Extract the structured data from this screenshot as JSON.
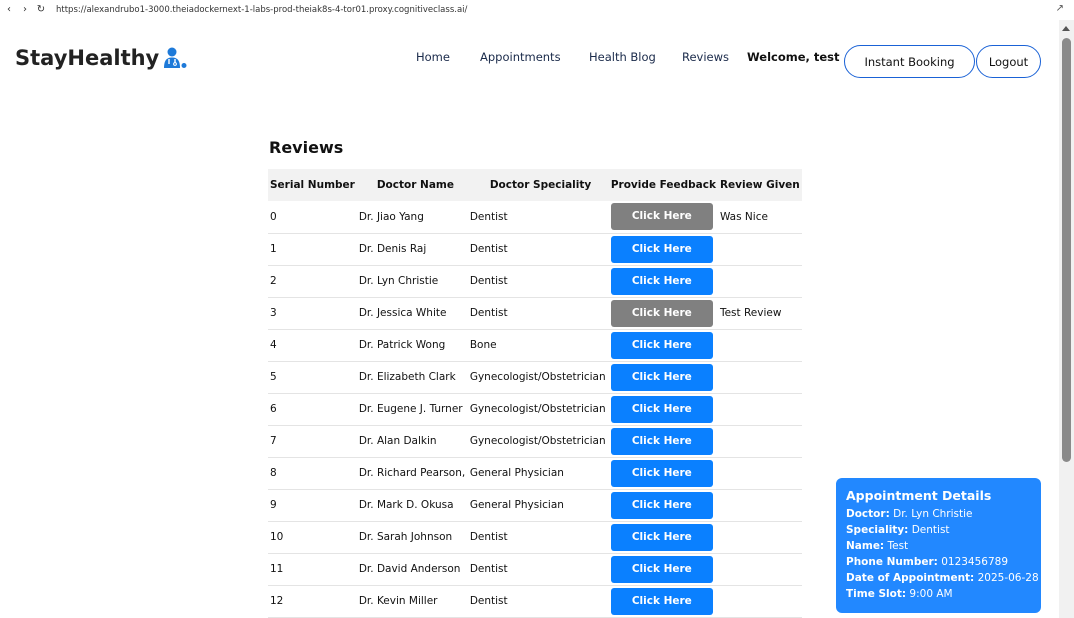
{
  "browser": {
    "url": "https://alexandrubo1-3000.theiadockernext-1-labs-prod-theiak8s-4-tor01.proxy.cognitiveclass.ai/"
  },
  "header": {
    "logo_text": "StayHealthy",
    "nav": {
      "home": "Home",
      "appointments": "Appointments",
      "blog": "Health Blog",
      "reviews": "Reviews"
    },
    "welcome": "Welcome, test",
    "instant_booking": "Instant Booking",
    "logout": "Logout"
  },
  "reviews": {
    "title": "Reviews",
    "columns": [
      "Serial Number",
      "Doctor Name",
      "Doctor Speciality",
      "Provide Feedback",
      "Review Given"
    ],
    "rows": [
      {
        "serial": "0",
        "doctor": "Dr. Jiao Yang",
        "speciality": "Dentist",
        "button": "Click Here",
        "disabled": true,
        "review": "Was Nice"
      },
      {
        "serial": "1",
        "doctor": "Dr. Denis Raj",
        "speciality": "Dentist",
        "button": "Click Here",
        "disabled": false,
        "review": ""
      },
      {
        "serial": "2",
        "doctor": "Dr. Lyn Christie",
        "speciality": "Dentist",
        "button": "Click Here",
        "disabled": false,
        "review": ""
      },
      {
        "serial": "3",
        "doctor": "Dr. Jessica White",
        "speciality": "Dentist",
        "button": "Click Here",
        "disabled": true,
        "review": "Test Review"
      },
      {
        "serial": "4",
        "doctor": "Dr. Patrick Wong",
        "speciality": "Bone",
        "button": "Click Here",
        "disabled": false,
        "review": ""
      },
      {
        "serial": "5",
        "doctor": "Dr. Elizabeth Clark",
        "speciality": "Gynecologist/Obstetrician",
        "button": "Click Here",
        "disabled": false,
        "review": ""
      },
      {
        "serial": "6",
        "doctor": "Dr. Eugene J. Turner",
        "speciality": "Gynecologist/Obstetrician",
        "button": "Click Here",
        "disabled": false,
        "review": ""
      },
      {
        "serial": "7",
        "doctor": "Dr. Alan Dalkin",
        "speciality": "Gynecologist/Obstetrician",
        "button": "Click Here",
        "disabled": false,
        "review": ""
      },
      {
        "serial": "8",
        "doctor": "Dr. Richard Pearson,",
        "speciality": "General Physician",
        "button": "Click Here",
        "disabled": false,
        "review": ""
      },
      {
        "serial": "9",
        "doctor": "Dr. Mark D. Okusa",
        "speciality": "General Physician",
        "button": "Click Here",
        "disabled": false,
        "review": ""
      },
      {
        "serial": "10",
        "doctor": "Dr. Sarah Johnson",
        "speciality": "Dentist",
        "button": "Click Here",
        "disabled": false,
        "review": ""
      },
      {
        "serial": "11",
        "doctor": "Dr. David Anderson",
        "speciality": "Dentist",
        "button": "Click Here",
        "disabled": false,
        "review": ""
      },
      {
        "serial": "12",
        "doctor": "Dr. Kevin Miller",
        "speciality": "Dentist",
        "button": "Click Here",
        "disabled": false,
        "review": ""
      }
    ]
  },
  "appointment": {
    "title": "Appointment Details",
    "doctor_label": "Doctor:",
    "doctor": "Dr. Lyn Christie",
    "speciality_label": "Speciality:",
    "speciality": "Dentist",
    "name_label": "Name:",
    "name": "Test",
    "phone_label": "Phone Number:",
    "phone": "0123456789",
    "date_label": "Date of Appointment:",
    "date": "2025-06-28",
    "slot_label": "Time Slot:",
    "slot": "9:00 AM"
  },
  "colors": {
    "accent": "#0a80ff",
    "disabled": "#808080",
    "card": "#2288ff",
    "logo_icon": "#1e7ad9"
  }
}
